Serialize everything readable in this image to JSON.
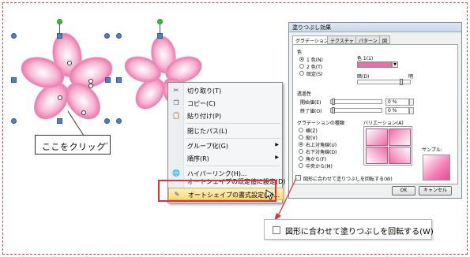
{
  "callout": {
    "text": "ここをクリック"
  },
  "context_menu": {
    "items": [
      {
        "label": "切り取り(T)",
        "icon": "scissors-icon"
      },
      {
        "label": "コピー(C)",
        "icon": "copy-icon"
      },
      {
        "label": "貼り付け(P)",
        "icon": "paste-icon"
      },
      {
        "label": "閉じたパス(L)",
        "icon": ""
      },
      {
        "label": "グループ化(G)",
        "icon": "",
        "submenu": true
      },
      {
        "label": "順序(R)",
        "icon": "",
        "submenu": true
      },
      {
        "label": "ハイパーリンク(H)...",
        "icon": "globe-link-icon"
      },
      {
        "label": "オートシェイプの既定値に設定(D)",
        "icon": ""
      },
      {
        "label": "オートシェイプの書式設定(O)...",
        "icon": "format-shape-icon"
      }
    ]
  },
  "dialog": {
    "title": "塗りつぶし効果",
    "tabs": [
      "グラデーション",
      "テクスチャ",
      "パターン",
      "図"
    ],
    "color_group": "色",
    "color_options": [
      "1 色(N)",
      "2 色(T)",
      "既定(S)"
    ],
    "color1_label": "色 1(1)",
    "dark_label": "暗(D)",
    "light_label": "明",
    "transparency_group": "透過性",
    "start_label": "開始値(E)",
    "end_label": "終了値(O)",
    "start_value": "0 %",
    "end_value": "0 %",
    "type_group": "グラデーションの種類",
    "types": [
      "横(Z)",
      "縦(V)",
      "右上対角線(U)",
      "右下対角線(D)",
      "角から(F)",
      "中央から(M)"
    ],
    "variation_group": "バリエーション(A)",
    "sample_label": "サンプル:",
    "rotate_checkbox": "図形に合わせて塗りつぶしを回転する(W)",
    "ok": "OK",
    "cancel": "キャンセル",
    "accent": "#ea6fa9"
  },
  "zoom_callout": {
    "text": "図形に合わせて塗りつぶしを回転する(W)"
  }
}
